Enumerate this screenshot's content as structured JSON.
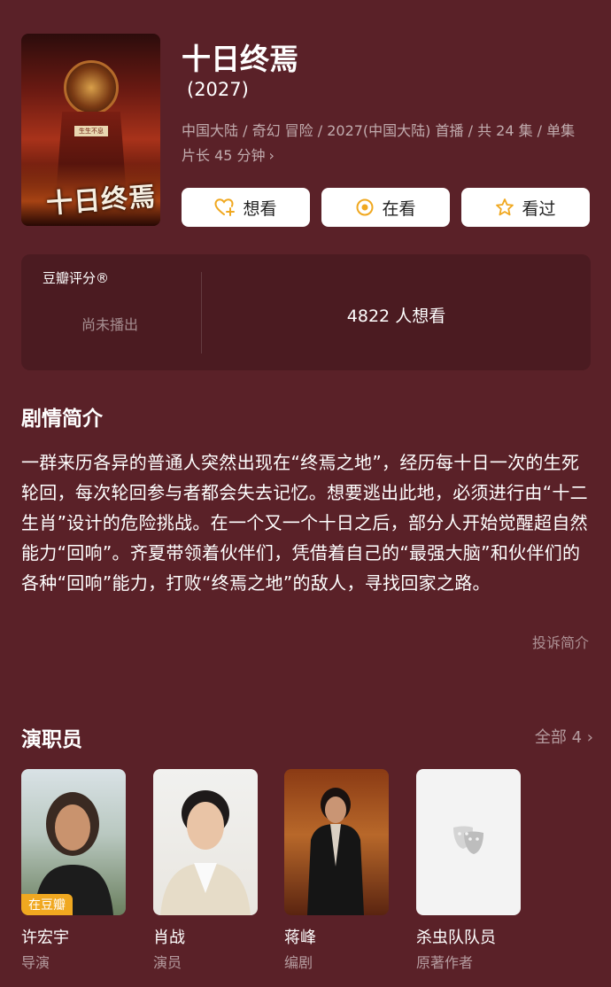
{
  "show": {
    "title": "十日终焉",
    "year": "(2027)",
    "meta_line1": "中国大陆 / 奇幻 冒险 / 2027(中国大陆) 首播 / 共 24 集 / 单集",
    "meta_line2": "片长 45 分钟",
    "poster_title": "十日终焉",
    "poster_sign": "生生不息"
  },
  "actions": {
    "want": "想看",
    "watching": "在看",
    "watched": "看过"
  },
  "rating": {
    "label": "豆瓣评分®",
    "status": "尚未播出",
    "wants": "4822 人想看"
  },
  "synopsis": {
    "heading": "剧情简介",
    "text": "一群来历各异的普通人突然出现在“终焉之地”，经历每十日一次的生死轮回，每次轮回参与者都会失去记忆。想要逃出此地，必须进行由“十二生肖”设计的危险挑战。在一个又一个十日之后，部分人开始觉醒超自然能力“回响”。齐夏带领着伙伴们，凭借着自己的“最强大脑”和伙伴们的各种“回响”能力，打败“终焉之地”的敌人，寻找回家之路。",
    "report": "投诉简介"
  },
  "cast": {
    "heading": "演职员",
    "all": "全部 4",
    "members": [
      {
        "name": "许宏宇",
        "role": "导演",
        "badge": "在豆瓣"
      },
      {
        "name": "肖战",
        "role": "演员"
      },
      {
        "name": "蒋峰",
        "role": "编剧"
      },
      {
        "name": "杀虫队队员",
        "role": "原著作者"
      }
    ]
  },
  "colors": {
    "background": "#5a2128",
    "card": "#4b1b21",
    "accent": "#f0a820"
  }
}
